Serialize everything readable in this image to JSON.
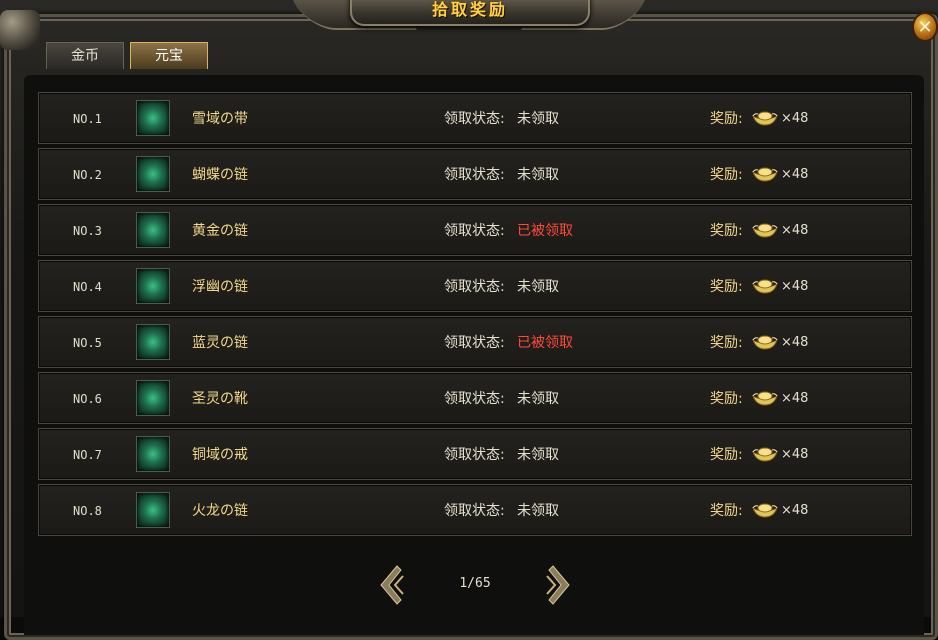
{
  "window": {
    "title": "拾取奖励",
    "close_symbol": "✕"
  },
  "tabs": [
    {
      "label": "金币",
      "active": false
    },
    {
      "label": "元宝",
      "active": true
    }
  ],
  "status_label": "领取状态:",
  "reward_label": "奖励:",
  "reward_icon": "gold-ingot-icon",
  "rows": [
    {
      "rank": "NO.1",
      "name": "雪域の带",
      "status": "未领取",
      "claimed": false,
      "reward": "×48"
    },
    {
      "rank": "NO.2",
      "name": "蝴蝶の链",
      "status": "未领取",
      "claimed": false,
      "reward": "×48"
    },
    {
      "rank": "NO.3",
      "name": "黄金の链",
      "status": "已被领取",
      "claimed": true,
      "reward": "×48"
    },
    {
      "rank": "NO.4",
      "name": "浮幽の链",
      "status": "未领取",
      "claimed": false,
      "reward": "×48"
    },
    {
      "rank": "NO.5",
      "name": "蓝灵の链",
      "status": "已被领取",
      "claimed": true,
      "reward": "×48"
    },
    {
      "rank": "NO.6",
      "name": "圣灵の靴",
      "status": "未领取",
      "claimed": false,
      "reward": "×48"
    },
    {
      "rank": "NO.7",
      "name": "铜域の戒",
      "status": "未领取",
      "claimed": false,
      "reward": "×48"
    },
    {
      "rank": "NO.8",
      "name": "火龙の链",
      "status": "未领取",
      "claimed": false,
      "reward": "×48"
    }
  ],
  "pagination": {
    "text": "1/65"
  },
  "colors": {
    "title": "#ffd24a",
    "claimed_status": "#ff4a3a",
    "unclaimed_status": "#e6e0cf",
    "item_name": "#f2d98a"
  }
}
